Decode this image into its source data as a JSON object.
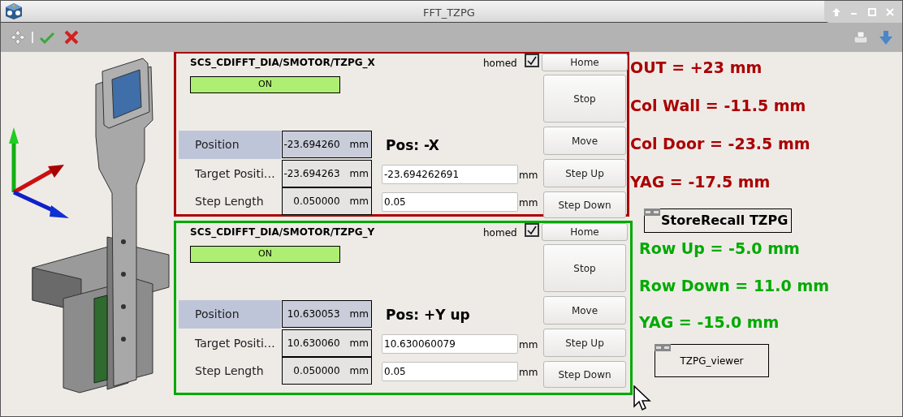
{
  "window": {
    "title": "FFT_TZPG"
  },
  "motors": [
    {
      "device": "SCS_CDIFFT_DIA/SMOTOR/TZPG_X",
      "color": "#aa0000",
      "state": "ON",
      "homed_label": "homed",
      "homed": true,
      "note": "Pos: -X",
      "buttons": [
        "Home",
        "Stop",
        "Move",
        "Step Up",
        "Step Down"
      ],
      "rows": [
        {
          "kind": "readback",
          "label": "Position",
          "value": "-23.694260",
          "unit": "mm"
        },
        {
          "kind": "setpoint",
          "label": "Target Positi…",
          "value": "-23.694263",
          "unit": "mm",
          "input": "-23.694262691",
          "input_unit": "mm"
        },
        {
          "kind": "setpoint",
          "label": "Step Length",
          "value": "0.050000",
          "unit": "mm",
          "input": "0.05",
          "input_unit": "mm"
        }
      ]
    },
    {
      "device": "SCS_CDIFFT_DIA/SMOTOR/TZPG_Y",
      "color": "#00aa00",
      "state": "ON",
      "homed_label": "homed",
      "homed": true,
      "note": "Pos: +Y up",
      "buttons": [
        "Home",
        "Stop",
        "Move",
        "Step Up",
        "Step Down"
      ],
      "rows": [
        {
          "kind": "readback",
          "label": "Position",
          "value": "10.630053",
          "unit": "mm"
        },
        {
          "kind": "setpoint",
          "label": "Target Positi…",
          "value": "10.630060",
          "unit": "mm",
          "input": "10.630060079",
          "input_unit": "mm"
        },
        {
          "kind": "setpoint",
          "label": "Step Length",
          "value": "0.050000",
          "unit": "mm",
          "input": "0.05",
          "input_unit": "mm"
        }
      ]
    }
  ],
  "presets": [
    {
      "text": "OUT = +23 mm",
      "color": "#aa0000"
    },
    {
      "text": "Col Wall = -11.5 mm",
      "color": "#aa0000"
    },
    {
      "text": "Col Door = -23.5 mm",
      "color": "#aa0000"
    },
    {
      "text": "YAG = -17.5 mm",
      "color": "#aa0000"
    },
    {
      "text": "Row Up = -5.0 mm",
      "color": "#00aa00"
    },
    {
      "text": "Row Down = 11.0 mm",
      "color": "#00aa00"
    },
    {
      "text": "YAG = -15.0 mm",
      "color": "#00aa00"
    }
  ],
  "scene_links": [
    {
      "kind": "large",
      "label": "StoreRecall TZPG"
    },
    {
      "kind": "small",
      "label": "TZPG_viewer"
    }
  ]
}
